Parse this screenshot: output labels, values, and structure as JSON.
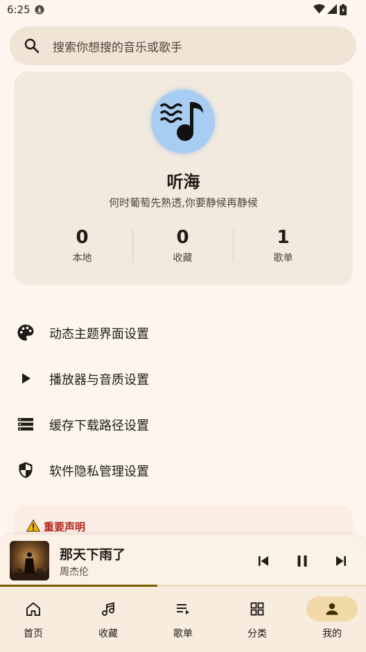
{
  "status_bar": {
    "time": "6:25"
  },
  "search": {
    "placeholder": "搜索你想搜的音乐或歌手"
  },
  "profile": {
    "name": "听海",
    "bio": "何时葡萄先熟透,你要静候再静候",
    "stats": [
      {
        "value": "0",
        "label": "本地"
      },
      {
        "value": "0",
        "label": "收藏"
      },
      {
        "value": "1",
        "label": "歌单"
      }
    ]
  },
  "settings": [
    {
      "label": "动态主题界面设置",
      "icon": "palette-icon"
    },
    {
      "label": "播放器与音质设置",
      "icon": "play-icon"
    },
    {
      "label": "缓存下载路径设置",
      "icon": "storage-icon"
    },
    {
      "label": "软件隐私管理设置",
      "icon": "shield-icon"
    }
  ],
  "notice": {
    "title": "重要声明"
  },
  "player": {
    "title": "那天下雨了",
    "artist": "周杰伦",
    "progress": 0.43
  },
  "nav": {
    "items": [
      {
        "label": "首页",
        "icon": "home-icon"
      },
      {
        "label": "收藏",
        "icon": "music-note-icon"
      },
      {
        "label": "歌单",
        "icon": "playlist-icon"
      },
      {
        "label": "分类",
        "icon": "grid-icon"
      },
      {
        "label": "我的",
        "icon": "person-icon"
      }
    ],
    "active_index": 4
  },
  "colors": {
    "background": "#fdf6ef",
    "accent_pill": "#f1d9a8",
    "progress": "#7a5d00",
    "warning": "#b3261e",
    "avatar": "#a8cdf2"
  }
}
